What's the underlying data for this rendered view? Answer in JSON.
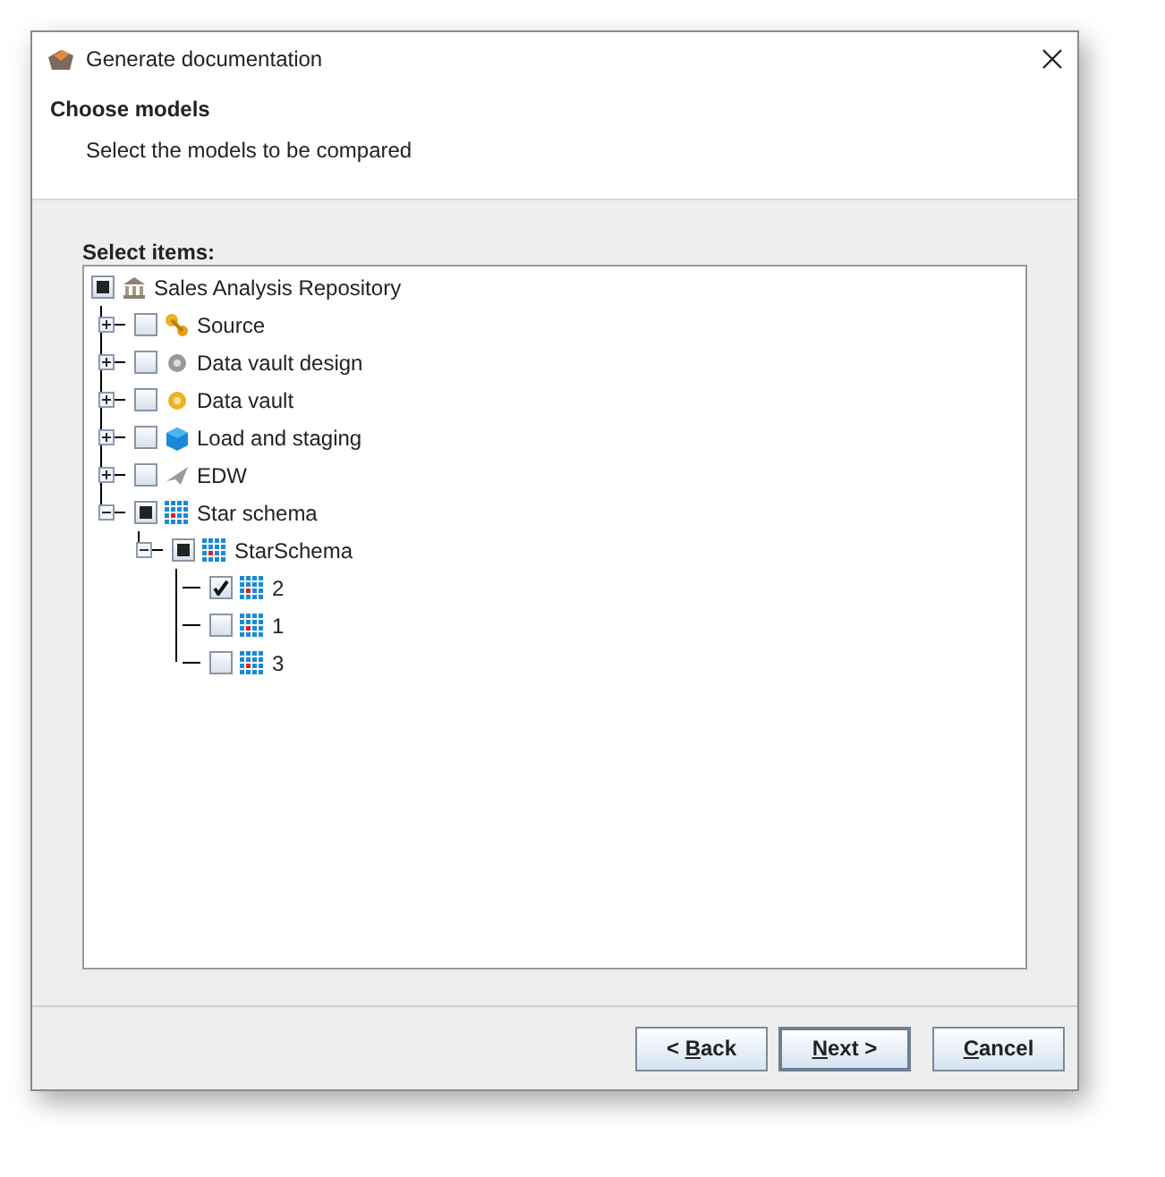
{
  "window": {
    "title": "Generate documentation"
  },
  "header": {
    "title": "Choose models",
    "subtitle": "Select the models to be compared"
  },
  "tree_label": "Select items:",
  "tree": [
    {
      "label": "Sales Analysis Repository",
      "kind": "repository",
      "checked": false,
      "partial": true,
      "children": [
        {
          "label": "Source",
          "kind": "source",
          "checked": false,
          "partial": false,
          "expanded": false
        },
        {
          "label": "Data vault design",
          "kind": "design",
          "checked": false,
          "partial": false,
          "expanded": false
        },
        {
          "label": "Data vault",
          "kind": "vault",
          "checked": false,
          "partial": false,
          "expanded": false
        },
        {
          "label": "Load and staging",
          "kind": "staging",
          "checked": false,
          "partial": false,
          "expanded": false
        },
        {
          "label": "EDW",
          "kind": "edw",
          "checked": false,
          "partial": false,
          "expanded": false
        },
        {
          "label": "Star schema",
          "kind": "star",
          "checked": false,
          "partial": true,
          "expanded": true,
          "children": [
            {
              "label": "StarSchema",
              "kind": "star",
              "checked": false,
              "partial": true,
              "expanded": true,
              "children": [
                {
                  "label": "2",
                  "kind": "star",
                  "checked": true
                },
                {
                  "label": "1",
                  "kind": "star",
                  "checked": false,
                  "partial": false
                },
                {
                  "label": "3",
                  "kind": "star",
                  "checked": false,
                  "partial": false
                }
              ]
            }
          ]
        }
      ]
    }
  ],
  "buttons": [
    {
      "pre": "< ",
      "key": "B",
      "post": "ack",
      "default": false
    },
    {
      "key": "N",
      "post": "ext >",
      "default": true
    },
    {
      "key": "C",
      "post": "ancel",
      "default": false
    }
  ]
}
